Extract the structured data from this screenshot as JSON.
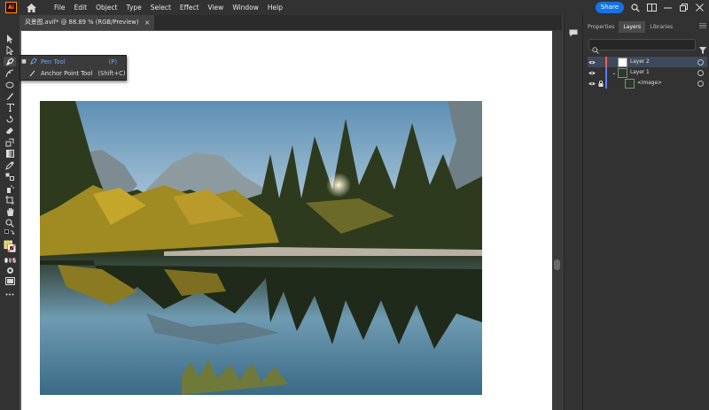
{
  "app": {
    "logo_text": "Ai",
    "menus": [
      "File",
      "Edit",
      "Object",
      "Type",
      "Select",
      "Effect",
      "View",
      "Window",
      "Help"
    ],
    "share_label": "Share",
    "icons": [
      "home-icon",
      "search-icon",
      "arrange-documents-icon",
      "minimize-icon",
      "restore-icon",
      "close-icon"
    ]
  },
  "document": {
    "tab_title": "风景图.avif* @ 88.89 % (RGB/Preview)",
    "close_label": "×"
  },
  "flyout": {
    "items": [
      {
        "label": "Pen Tool",
        "shortcut": "(P)"
      },
      {
        "label": "Anchor Point Tool",
        "shortcut": "(Shift+C)"
      }
    ]
  },
  "panel": {
    "tabs": [
      "Properties",
      "Layers",
      "Libraries"
    ],
    "active_tab": "Layers",
    "search_placeholder": "",
    "layers": [
      {
        "name": "Layer 2",
        "color": "#f05a5a",
        "selected": true
      },
      {
        "name": "Layer 1",
        "color": "#5b7bff",
        "selected": false
      },
      {
        "name": "<Image>",
        "color": "#5b7bff",
        "selected": false
      }
    ]
  },
  "colors": {
    "accent": "#1473e6",
    "fill_swatch": "#e8d24a",
    "stroke_swatch": "#ffffff"
  }
}
